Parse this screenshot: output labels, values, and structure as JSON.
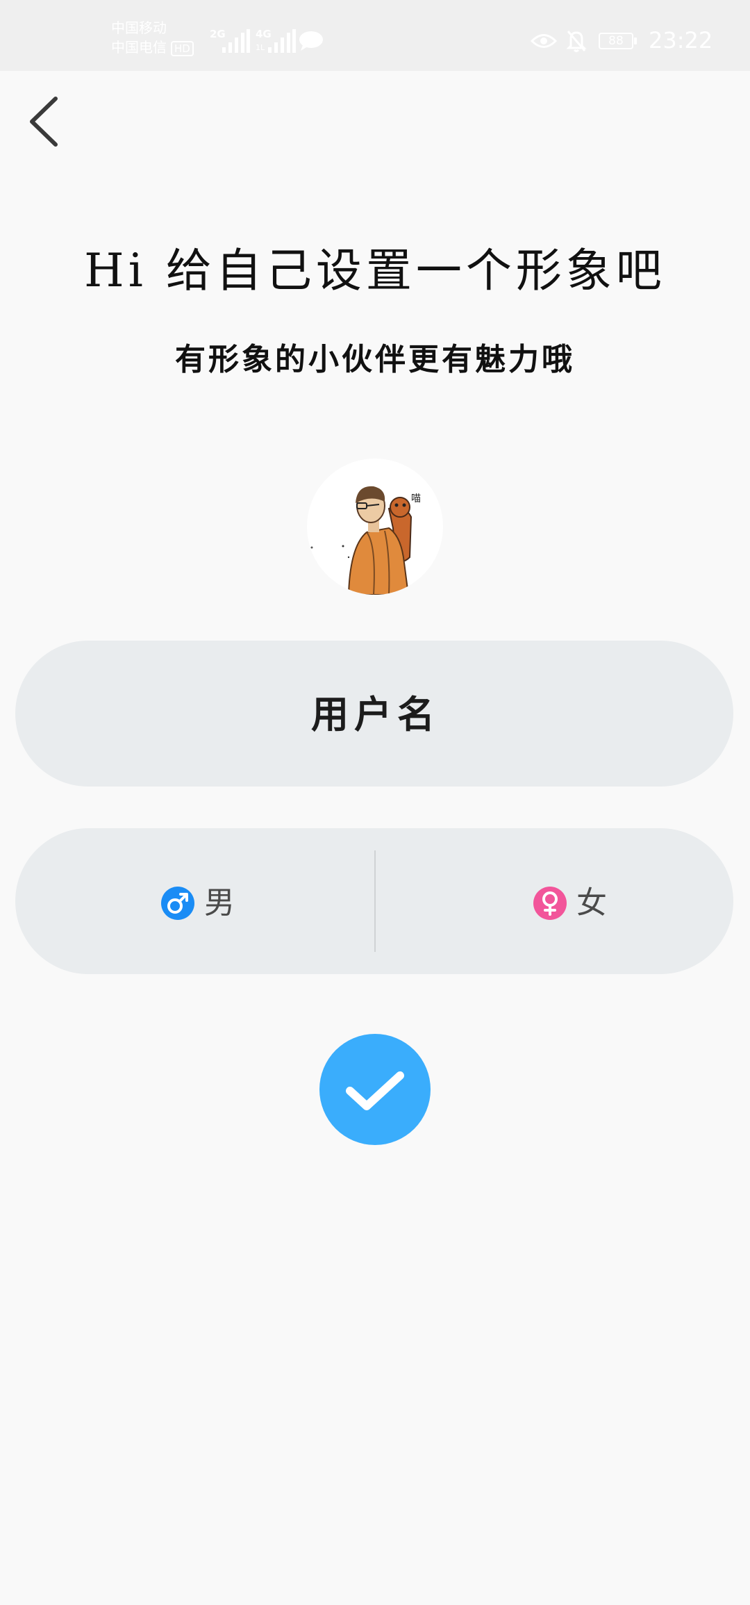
{
  "status_bar": {
    "carrier_1": "中国移动",
    "carrier_2": "中国电信",
    "hd_badge": "HD",
    "network_1": "2G",
    "network_2": "4G",
    "network_2_sub": "1L",
    "battery_level": "88",
    "time": "23:22"
  },
  "header": {
    "title": "Hi 给自己设置一个形象吧",
    "subtitle": "有形象的小伙伴更有魅力哦"
  },
  "form": {
    "username_placeholder": "用户名",
    "username_value": "",
    "gender": {
      "male_label": "男",
      "female_label": "女",
      "selected": ""
    }
  },
  "colors": {
    "background": "#f9f9f9",
    "status_bar": "#efefef",
    "pill": "#e9ecee",
    "confirm": "#3aadfc",
    "male": "#1a8cf5",
    "female": "#f2559a"
  },
  "icons": {
    "back": "chevron-left-icon",
    "confirm": "check-icon",
    "male": "male-symbol-icon",
    "female": "female-symbol-icon"
  }
}
